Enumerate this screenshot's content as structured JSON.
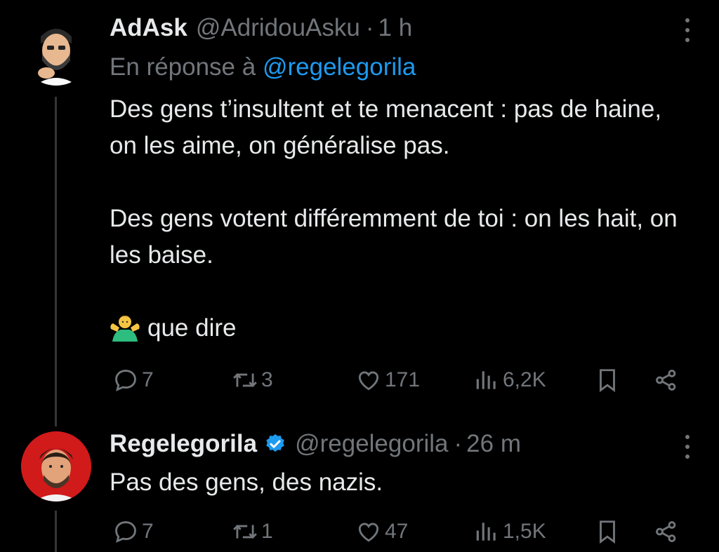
{
  "tweets": [
    {
      "display_name": "AdAsk",
      "handle": "@AdridouAsku",
      "separator": "·",
      "time": "1 h",
      "reply_prefix": "En réponse à",
      "reply_mention": "@regelegorila",
      "paragraphs": [
        "Des gens t’insultent et te menacent : pas de haine, on les aime, on généralise pas.",
        "Des gens votent différemment de toi : on les hait, on les baise.",
        "que dire"
      ],
      "emoji": "person-shrugging",
      "counts": {
        "replies": "7",
        "retweets": "3",
        "likes": "171",
        "views": "6,2K"
      }
    },
    {
      "display_name": "Regelegorila",
      "verified": true,
      "handle": "@regelegorila",
      "separator": "·",
      "time": "26 m",
      "text": "Pas des gens, des nazis.",
      "counts": {
        "replies": "7",
        "retweets": "1",
        "likes": "47",
        "views": "1,5K"
      }
    }
  ],
  "colors": {
    "background": "#000000",
    "text": "#e7e9ea",
    "muted": "#71767b",
    "link": "#1d9bf0",
    "verified": "#1d9bf0"
  },
  "icons": [
    "reply-icon",
    "retweet-icon",
    "like-icon",
    "views-icon",
    "bookmark-icon",
    "share-icon",
    "more-icon",
    "verified-icon",
    "shrug-emoji"
  ]
}
